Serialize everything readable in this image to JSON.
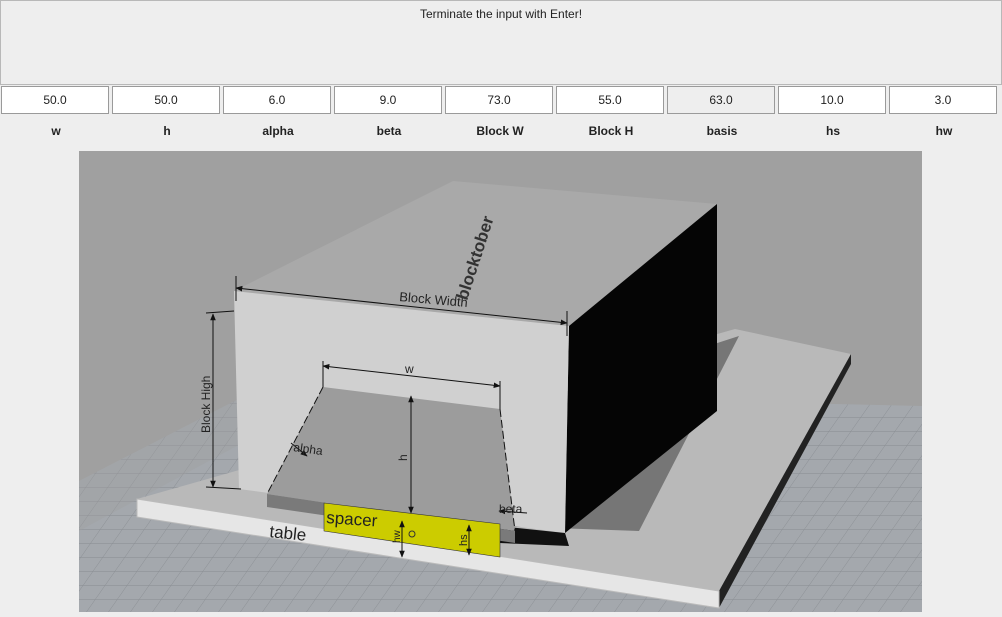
{
  "message": "Terminate the input with Enter!",
  "parameters": [
    {
      "label": "w",
      "value": "50.0"
    },
    {
      "label": "h",
      "value": "50.0"
    },
    {
      "label": "alpha",
      "value": "6.0"
    },
    {
      "label": "beta",
      "value": "9.0"
    },
    {
      "label": "Block W",
      "value": "73.0"
    },
    {
      "label": "Block H",
      "value": "55.0"
    },
    {
      "label": "basis",
      "value": "63.0"
    },
    {
      "label": "hs",
      "value": "10.0"
    },
    {
      "label": "hw",
      "value": "3.0"
    }
  ],
  "scene": {
    "block_width": "Block Width",
    "block_high": "Block High",
    "w": "w",
    "h": "h",
    "alpha": "alpha",
    "beta": "beta",
    "spacer": "spacer",
    "table": "table",
    "hs": "hs",
    "hw": "hw",
    "logo": "blocktober"
  }
}
